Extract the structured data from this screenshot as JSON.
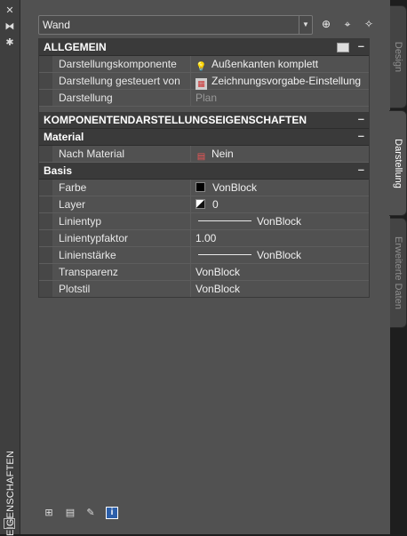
{
  "palette": {
    "title": "EIGENSCHAFTEN"
  },
  "object_select": {
    "value": "Wand"
  },
  "tabs": {
    "design": "Design",
    "darstellung": "Darstellung",
    "erweiterte": "Erweiterte Daten"
  },
  "sections": {
    "allgemein": {
      "title": "ALLGEMEIN",
      "collapse": "–",
      "rows": [
        {
          "label": "Darstellungskomponente",
          "value": "Außenkanten komplett",
          "icon": "bulb-icon"
        },
        {
          "label": "Darstellung gesteuert von",
          "value": "Zeichnungsvorgabe-Einstellung",
          "icon": "document-icon"
        },
        {
          "label": "Darstellung",
          "value": "Plan"
        }
      ]
    },
    "komponenten": {
      "title": "KOMPONENTENDARSTELLUNGSEIGENSCHAFTEN",
      "collapse": "–"
    },
    "material": {
      "title": "Material",
      "collapse": "–",
      "rows": [
        {
          "label": "Nach Material",
          "value": "Nein",
          "icon": "material-icon"
        }
      ]
    },
    "basis": {
      "title": "Basis",
      "collapse": "–",
      "rows": [
        {
          "label": "Farbe",
          "value": "VonBlock",
          "icon": "black-color-swatch"
        },
        {
          "label": "Layer",
          "value": "0",
          "icon": "layer-swatch"
        },
        {
          "label": "Linientyp",
          "value": "VonBlock",
          "icon": "line-sample"
        },
        {
          "label": "Linientypfaktor",
          "value": "1.00"
        },
        {
          "label": "Linienstärke",
          "value": "VonBlock",
          "icon": "line-sample"
        },
        {
          "label": "Transparenz",
          "value": "VonBlock"
        },
        {
          "label": "Plotstil",
          "value": "VonBlock"
        }
      ]
    }
  },
  "colors": {
    "panel": "#515151",
    "section_header": "#3a3a3a",
    "background": "#1e1e1e"
  }
}
